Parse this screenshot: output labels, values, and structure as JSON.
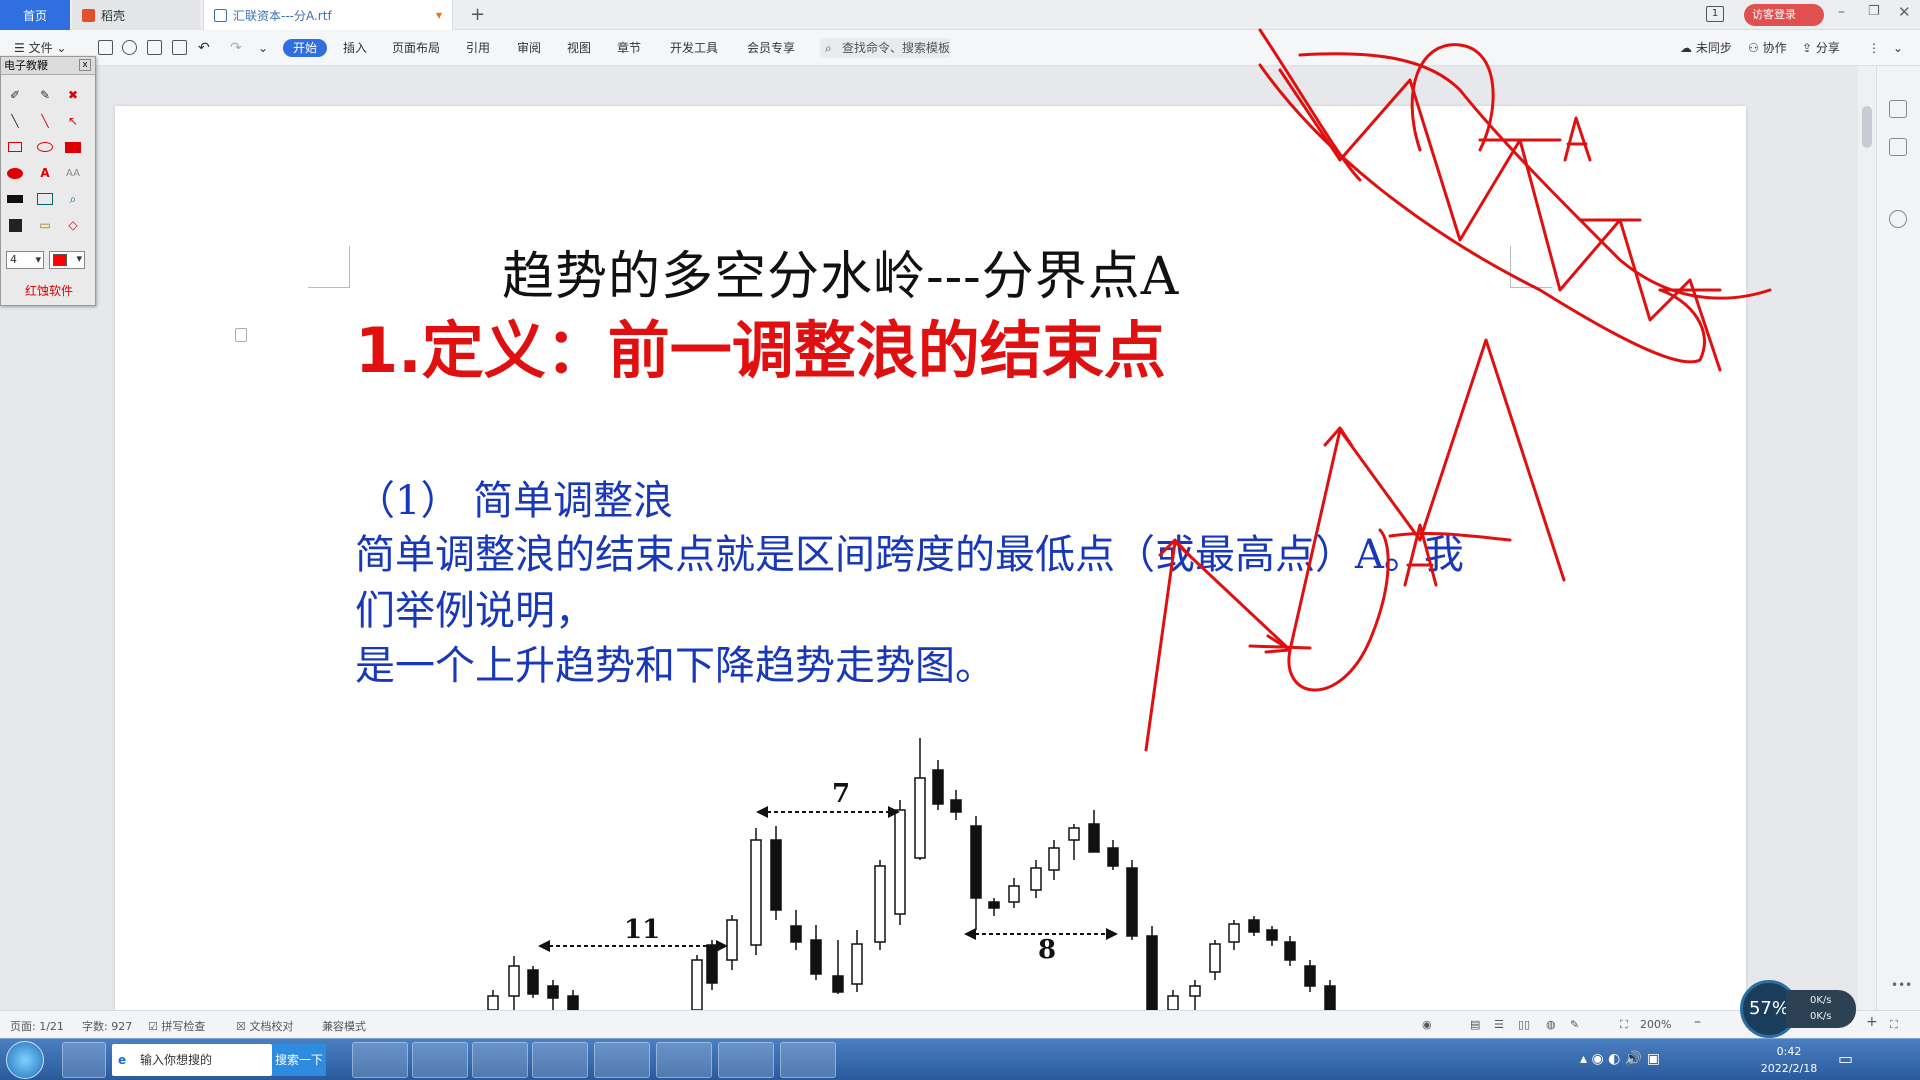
{
  "tabs": {
    "home": "首页",
    "daoke": "稻壳",
    "doc": "汇联资本---分A.rtf"
  },
  "user": {
    "login": "访客登录"
  },
  "toolbar": {
    "file": "文件",
    "start": "开始",
    "insert": "插入",
    "layout": "页面布局",
    "ref": "引用",
    "review": "审阅",
    "view": "视图",
    "chapter": "章节",
    "dev": "开发工具",
    "vip": "会员专享",
    "search_placeholder": "查找命令、搜索模板",
    "sync": "未同步",
    "collab": "协作",
    "share": "分享"
  },
  "panel": {
    "title": "电子教鞭",
    "size": "4",
    "footer": "红蚀软件"
  },
  "document": {
    "title": "趋势的多空分水岭---分界点A",
    "h1": "1.定义：前一调整浪的结束点",
    "h2": "（1） 简单调整浪",
    "p1": "简单调整浪的结束点就是区间跨度的最低点（或最高点）A。我",
    "p1b": "们举例说明，",
    "p2": "是一个上升趋势和下降趋势走势图。"
  },
  "chart_data": {
    "type": "candlestick",
    "annotations": [
      "7",
      "11",
      "8"
    ]
  },
  "status": {
    "page": "页面: 1/21",
    "words": "字数: 927",
    "spell": "拼写检查",
    "proof": "文档校对",
    "compat": "兼容模式",
    "zoom": "200%"
  },
  "taskbar": {
    "search_placeholder": "输入你想搜的",
    "search_button": "搜索一下",
    "time": "0:42",
    "date": "2022/2/18"
  },
  "speed": {
    "percent": "57%",
    "up": "0K/s",
    "down": "0K/s"
  },
  "colors": {
    "accent": "#2f6fe0",
    "annotation": "#e01010",
    "body_text": "#1838b8"
  }
}
